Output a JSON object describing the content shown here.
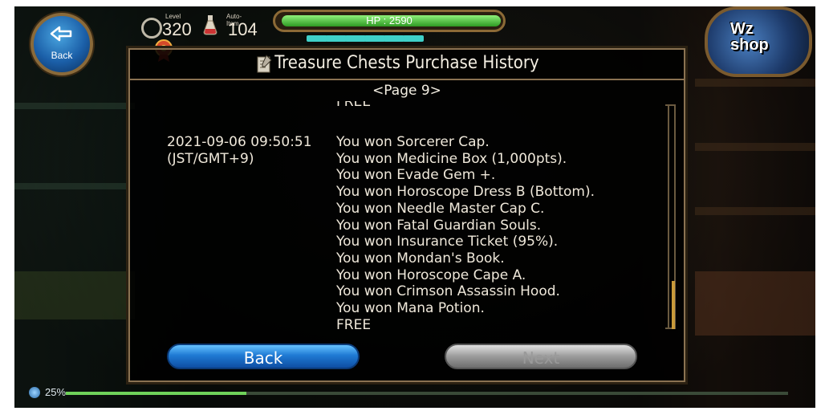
{
  "hud": {
    "back_label": "Back",
    "level_label": "Level",
    "level_value": "320",
    "auto_item_label": "Auto-Item",
    "auto_item_value": "104",
    "hp_text": "HP : 2590",
    "exp_text": "25%",
    "exp_fraction": 0.25,
    "mp_segments": 6
  },
  "logo": {
    "line1": "Wz",
    "line2": "shop"
  },
  "panel": {
    "title": "Treasure Chests Purchase History",
    "page_label": "<Page 9>",
    "prev_entry_tail": "FREE",
    "entry": {
      "datetime": "2021-09-06 09:50:51",
      "timezone": "(JST/GMT+9)",
      "items": [
        "You won Sorcerer Cap.",
        "You won Medicine Box (1,000pts).",
        "You won Evade Gem +.",
        "You won Horoscope Dress B (Bottom).",
        "You won Needle Master Cap C.",
        "You won Fatal Guardian Souls.",
        "You won Insurance Ticket (95%).",
        "You won Mondan's Book.",
        "You won Horoscope Cape A.",
        "You won Crimson Assassin Hood.",
        "You won Mana Potion.",
        "FREE"
      ]
    },
    "back_button": "Back",
    "next_button": "Next"
  },
  "colors": {
    "hp_fill": "#2e9a23",
    "mp_segment": "#3fd0c8",
    "back_button": "#1f7ad4",
    "next_button_disabled": "#9b9b9b",
    "frame_gold": "#8a7252"
  }
}
